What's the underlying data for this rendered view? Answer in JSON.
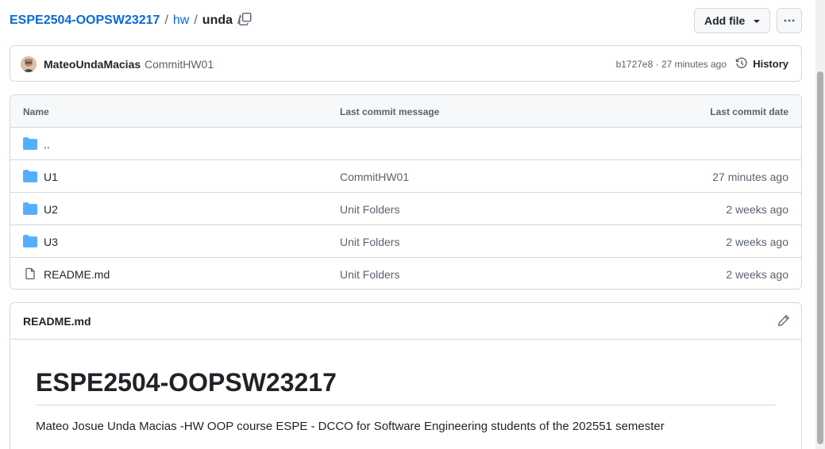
{
  "breadcrumb": {
    "repo": "ESPE2504-OOPSW23217",
    "folder": "hw",
    "current": "unda",
    "sep": "/"
  },
  "toolbar": {
    "add_file_label": "Add file",
    "more_icon": "kebab-horizontal-icon",
    "copy_icon": "copy-icon"
  },
  "commit": {
    "author": "MateoUndaMacias",
    "message": "CommitHW01",
    "meta": "b1727e8 · 27 minutes ago",
    "history_label": "History"
  },
  "table": {
    "headers": {
      "name": "Name",
      "message": "Last commit message",
      "date": "Last commit date"
    },
    "rows": [
      {
        "name": "..",
        "message": "",
        "date": "",
        "type": "folder"
      },
      {
        "name": "U1",
        "message": "CommitHW01",
        "date": "27 minutes ago",
        "type": "folder"
      },
      {
        "name": "U2",
        "message": "Unit Folders",
        "date": "2 weeks ago",
        "type": "folder"
      },
      {
        "name": "U3",
        "message": "Unit Folders",
        "date": "2 weeks ago",
        "type": "folder"
      },
      {
        "name": "README.md",
        "message": "Unit Folders",
        "date": "2 weeks ago",
        "type": "file"
      }
    ]
  },
  "readme": {
    "filename": "README.md",
    "heading": "ESPE2504-OOPSW23217",
    "paragraph": "Mateo Josue Unda Macias -HW OOP course ESPE - DCCO for Software Engineering students of the 202551 semester"
  },
  "colors": {
    "link": "#0969da",
    "folder": "#54aeff",
    "muted": "#59636e",
    "border": "#d1d9e0"
  }
}
